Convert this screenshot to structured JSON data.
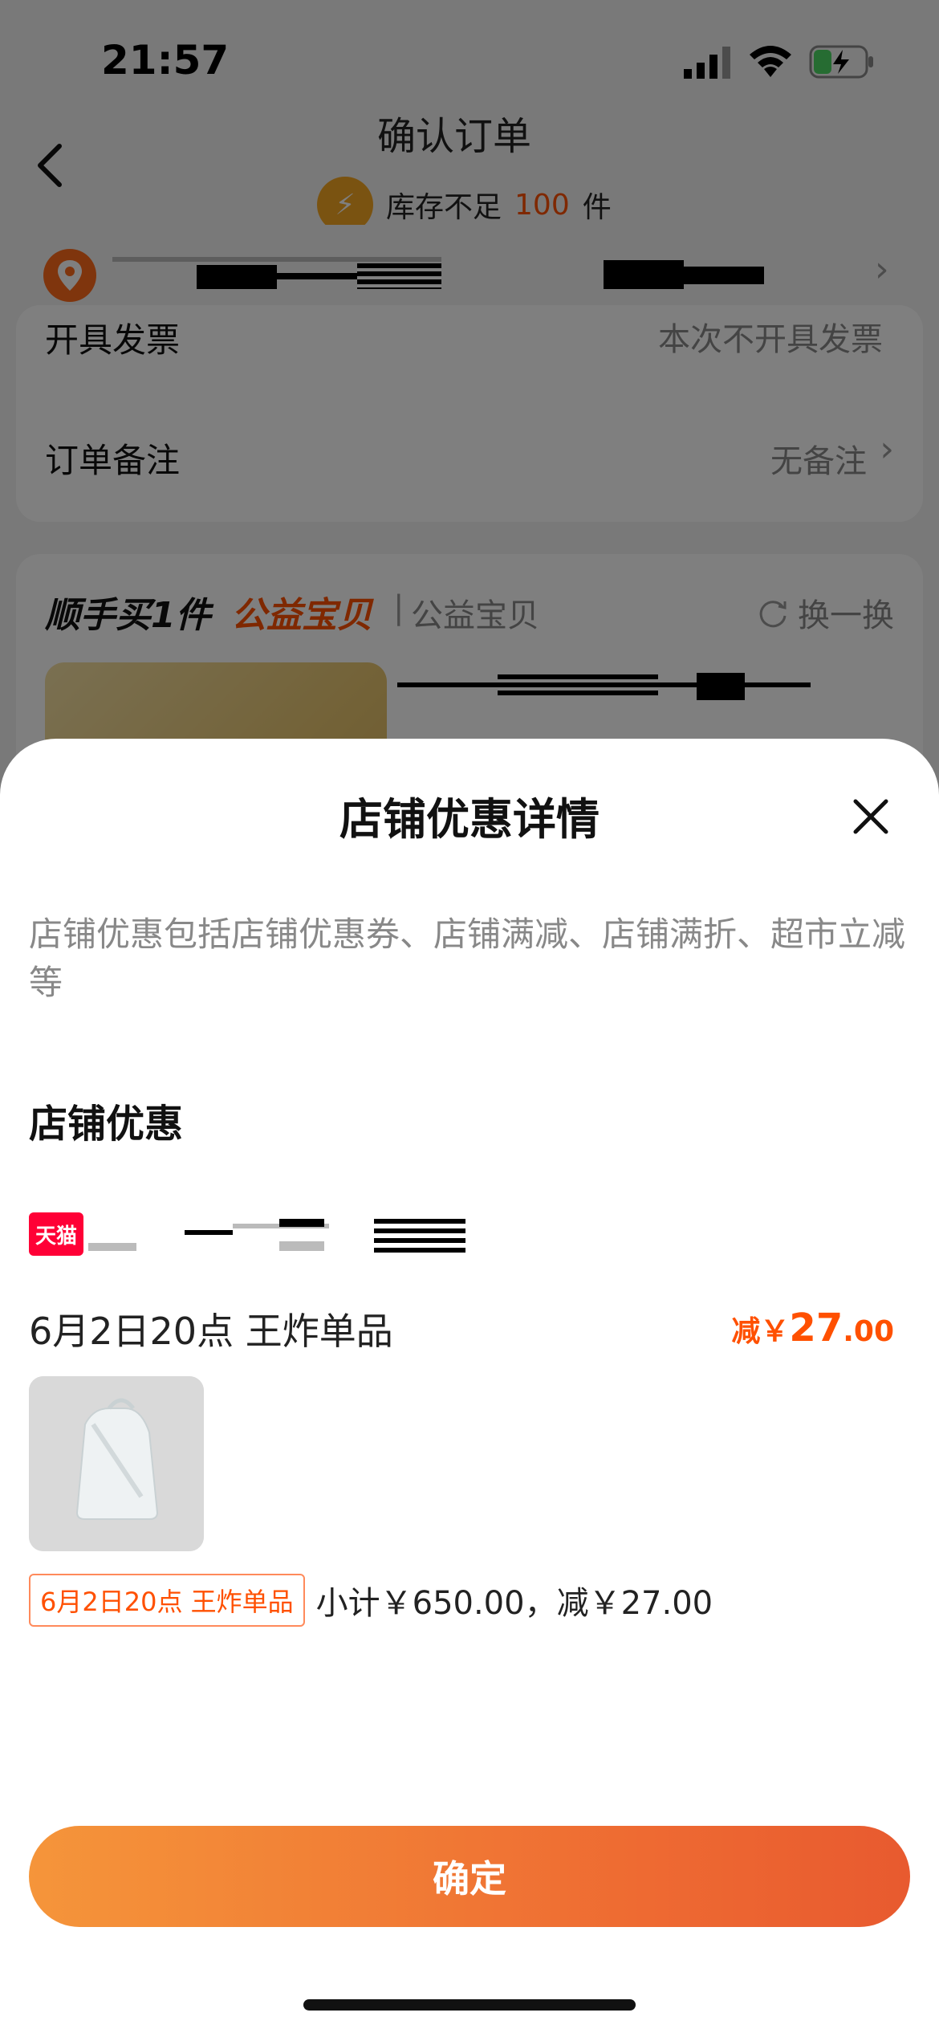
{
  "status_bar": {
    "time": "21:57"
  },
  "background": {
    "title": "确认订单",
    "stock_text": "库存不足",
    "stock_count": "100",
    "stock_unit": "件",
    "rows": [
      {
        "label": "开具发票",
        "value": "本次不开具发票"
      },
      {
        "label": "订单备注",
        "value": "无备注"
      }
    ],
    "promo": {
      "title": "顺手买1件",
      "tag": "公益宝贝",
      "sub": "公益宝贝",
      "swap": "换一换"
    }
  },
  "sheet": {
    "title": "店铺优惠详情",
    "description": "店铺优惠包括店铺优惠券、店铺满减、店铺满折、超市立减等",
    "section_title": "店铺优惠",
    "shop_logo_text": "天猫",
    "event_name": "6月2日20点 王炸单品",
    "discount_prefix": "减￥",
    "discount_integer": "27",
    "discount_decimal": ".00",
    "tag_label": "6月2日20点 王炸单品",
    "subtotal_text": "小计￥650.00，减￥27.00",
    "confirm_label": "确定"
  },
  "colors": {
    "accent": "#ff5000",
    "button_start": "#f5953a",
    "button_end": "#e85a2f",
    "tmall_red": "#ff0036"
  },
  "icons": [
    "signal-icon",
    "wifi-icon",
    "battery-charging-icon",
    "back-icon",
    "location-pin-icon",
    "chevron-right-icon",
    "refresh-icon",
    "close-icon"
  ]
}
